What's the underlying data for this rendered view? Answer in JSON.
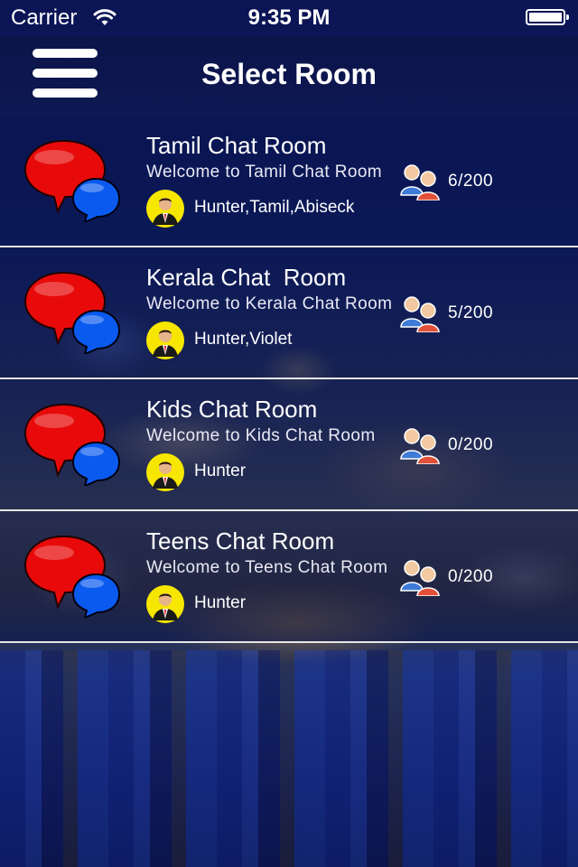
{
  "status_bar": {
    "carrier": "Carrier",
    "time": "9:35 PM"
  },
  "nav": {
    "title": "Select Room",
    "menu_icon": "hamburger-menu-icon"
  },
  "rooms": [
    {
      "name": "Tamil Chat Room",
      "welcome": "Welcome to Tamil Chat Room",
      "users": "Hunter,Tamil,Abiseck",
      "count": "6/200"
    },
    {
      "name": "Kerala Chat  Room",
      "welcome": "Welcome to Kerala Chat Room",
      "users": "Hunter,Violet",
      "count": "5/200"
    },
    {
      "name": "Kids Chat Room",
      "welcome": "Welcome to Kids Chat Room",
      "users": "Hunter",
      "count": "0/200"
    },
    {
      "name": "Teens Chat Room",
      "welcome": "Welcome to Teens Chat Room",
      "users": "Hunter",
      "count": "0/200"
    }
  ],
  "icons": {
    "room": "chat-bubbles-icon",
    "avatar": "user-avatar-icon",
    "people": "people-icon"
  },
  "colors": {
    "bubble_red": "#e80a0a",
    "bubble_blue": "#0a5af0",
    "avatar_bg": "#f7e600",
    "divider": "#e6e6e6"
  }
}
